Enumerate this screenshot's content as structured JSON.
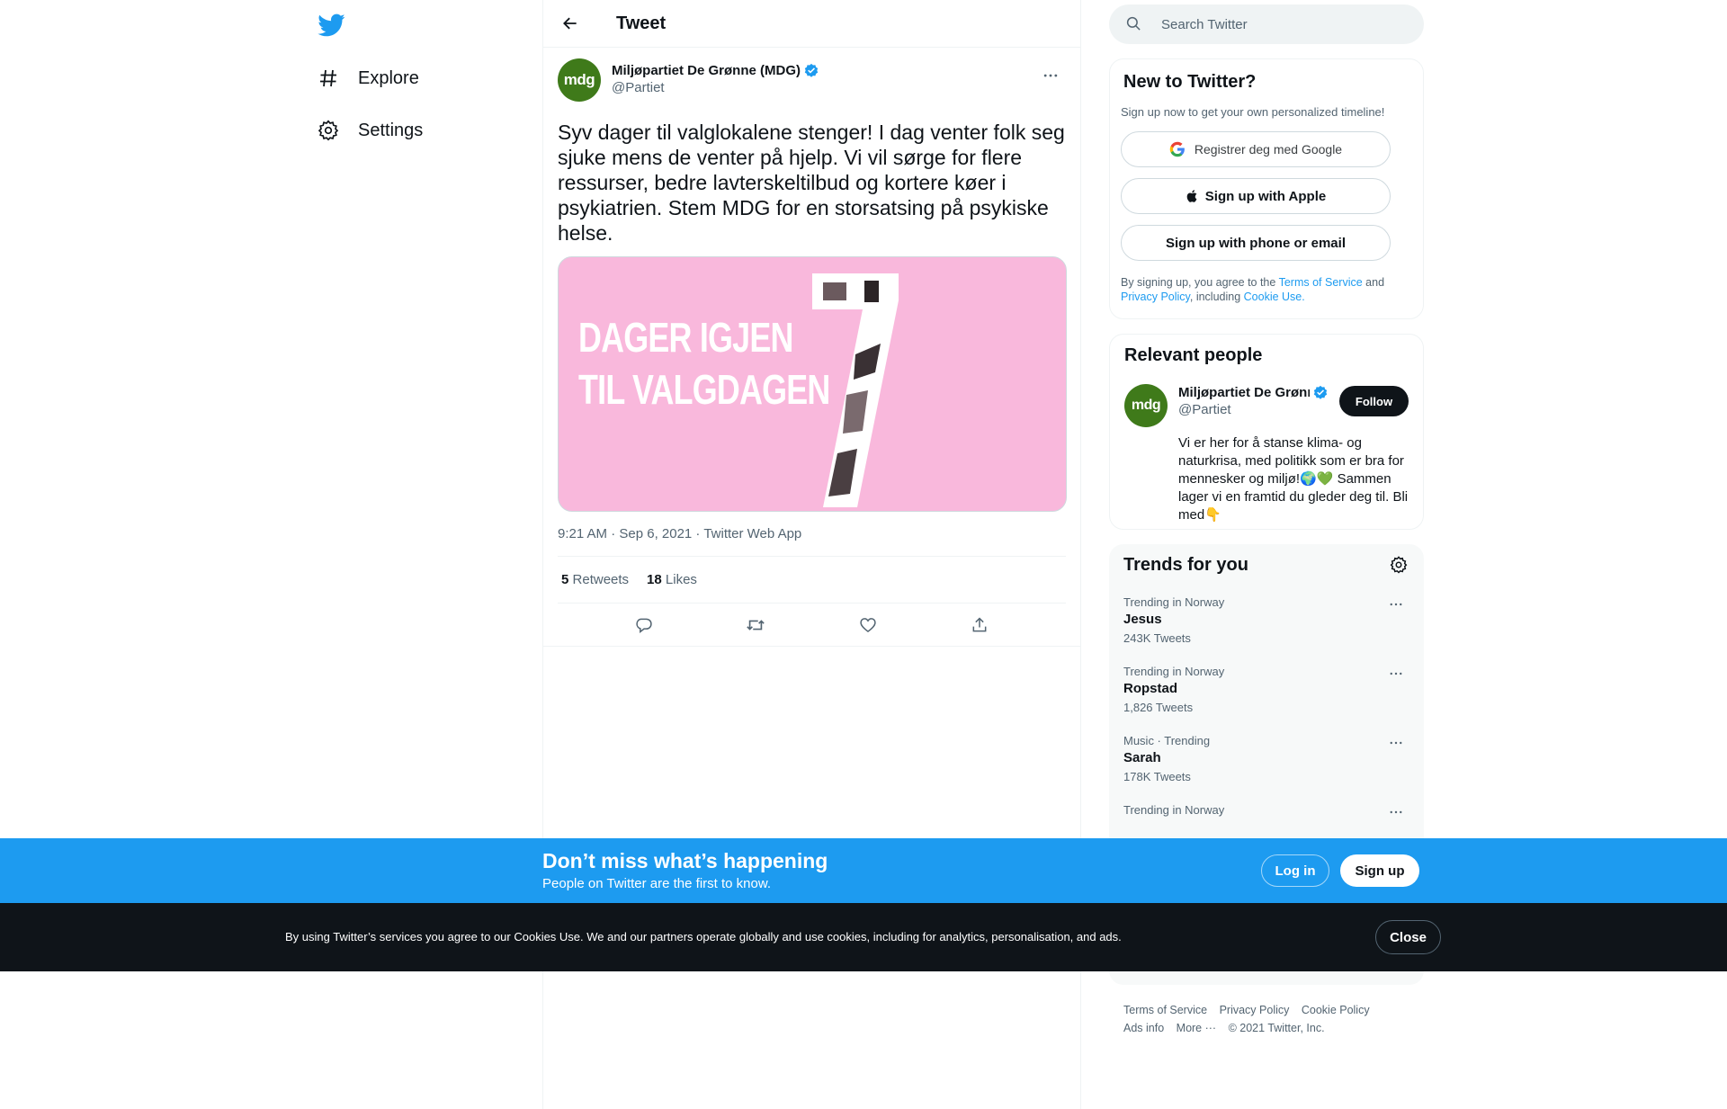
{
  "nav": {
    "explore_label": "Explore",
    "settings_label": "Settings"
  },
  "header": {
    "title": "Tweet"
  },
  "tweet": {
    "author_name": "Miljøpartiet De Grønne (MDG)",
    "author_handle": "@Partiet",
    "avatar_text": "mdg",
    "text": "Syv dager til valglokalene stenger! I dag venter folk seg sjuke mens de venter på hjelp. Vi vil sørge for flere ressurser, bedre lavterskeltilbud og kortere køer i psykiatrien. Stem MDG for en storsatsing på psykiske helse.",
    "image_line1": "DAGER IGJEN",
    "image_line2": "TIL VALGDAGEN",
    "image_number": "7",
    "timestamp": "9:21 AM · Sep 6, 2021 · Twitter Web App",
    "retweets_count": "5",
    "retweets_label": "Retweets",
    "likes_count": "18",
    "likes_label": "Likes"
  },
  "search": {
    "placeholder": "Search Twitter"
  },
  "signup": {
    "title": "New to Twitter?",
    "subtitle": "Sign up now to get your own personalized timeline!",
    "google_label": "Registrer deg med Google",
    "apple_label": "Sign up with Apple",
    "phone_label": "Sign up with phone or email",
    "legal_prefix": "By signing up, you agree to the ",
    "terms": "Terms of Service",
    "and": " and ",
    "privacy": "Privacy Policy",
    "including": ", including ",
    "cookie": "Cookie Use."
  },
  "people": {
    "title": "Relevant people",
    "name": "Miljøpartiet De Grønne (MDG)",
    "handle": "@Partiet",
    "follow_label": "Follow",
    "bio": "Vi er her for å stanse klima- og naturkrisa, med politikk som er bra for mennesker og miljø!🌍💚 Sammen lager vi en framtid du gleder deg til. Bli med👇"
  },
  "trends": {
    "title": "Trends for you",
    "items": [
      {
        "meta": "Trending in Norway",
        "name": "Jesus",
        "count": "243K Tweets"
      },
      {
        "meta": "Trending in Norway",
        "name": "Ropstad",
        "count": "1,826 Tweets"
      },
      {
        "meta": "Music · Trending",
        "name": "Sarah",
        "count": "178K Tweets"
      },
      {
        "meta": "Trending in Norway",
        "name": "",
        "count": ""
      }
    ]
  },
  "footer": {
    "terms": "Terms of Service",
    "privacy": "Privacy Policy",
    "cookie": "Cookie Policy",
    "ads": "Ads info",
    "more": "More ···",
    "copyright": "© 2021 Twitter, Inc."
  },
  "promo": {
    "title": "Don’t miss what’s happening",
    "subtitle": "People on Twitter are the first to know.",
    "login_label": "Log in",
    "signup_label": "Sign up"
  },
  "cookie_bar": {
    "text": "By using Twitter’s services you agree to our Cookies Use. We and our partners operate globally and use cookies, including for analytics, personalisation, and ads.",
    "close_label": "Close"
  },
  "colors": {
    "brand": "#1d9bf0",
    "text": "#0f1419",
    "muted": "#536471",
    "avatar": "#3f7a1a",
    "image_bg": "#f9b8dc"
  },
  "icons": [
    "twitter-logo-icon",
    "hashtag-icon",
    "gear-icon",
    "back-arrow-icon",
    "verified-icon",
    "more-icon",
    "reply-icon",
    "retweet-icon",
    "like-icon",
    "share-icon",
    "search-icon",
    "google-icon",
    "apple-icon"
  ]
}
